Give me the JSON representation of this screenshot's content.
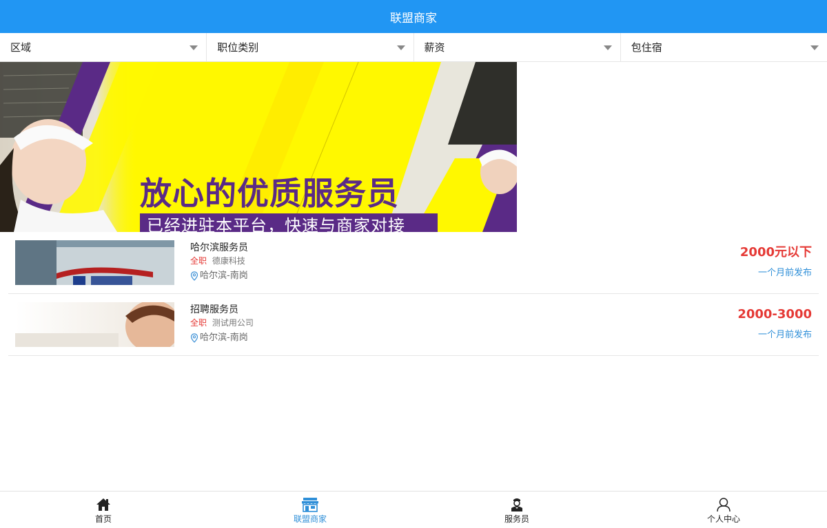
{
  "header": {
    "title": "联盟商家"
  },
  "filters": [
    {
      "label": "区域"
    },
    {
      "label": "职位类别"
    },
    {
      "label": "薪资"
    },
    {
      "label": "包住宿"
    }
  ],
  "banner": {
    "title": "放心的优质服务员",
    "subtitle": "已经进驻本平台，快速与商家对接",
    "colors": {
      "background": "#fff800",
      "accent": "#5a2a86"
    }
  },
  "jobs": [
    {
      "title": "哈尔滨服务员",
      "type": "全职",
      "company": "德康科技",
      "location": "哈尔滨-南岗",
      "salary": "2000元以下",
      "posted": "一个月前发布"
    },
    {
      "title": "招聘服务员",
      "type": "全职",
      "company": "测试用公司",
      "location": "哈尔滨-南岗",
      "salary": "2000-3000",
      "posted": "一个月前发布"
    }
  ],
  "tabbar": {
    "items": [
      {
        "label": "首页",
        "icon": "home-icon"
      },
      {
        "label": "联盟商家",
        "icon": "store-icon",
        "active": true
      },
      {
        "label": "服务员",
        "icon": "waiter-icon"
      },
      {
        "label": "个人中心",
        "icon": "user-icon"
      }
    ],
    "active_color": "#2f8fd8"
  },
  "colors": {
    "primary": "#2196f3",
    "salary": "#e53935",
    "link": "#2f8fd8"
  }
}
